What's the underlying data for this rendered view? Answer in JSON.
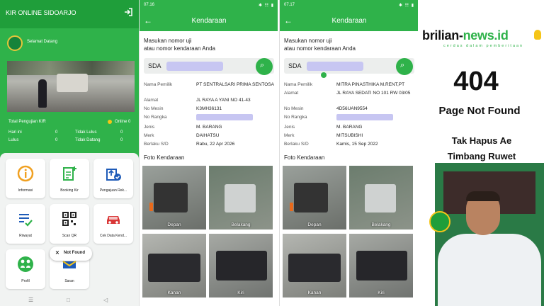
{
  "app": {
    "title": "KIR ONLINE SIDOARJO",
    "welcome": "Selamat Datang",
    "stats_title": "Total Pengujian KIR",
    "online_label": "Online 0",
    "stats": [
      {
        "label": "Hari ini",
        "value": "0"
      },
      {
        "label": "Lulus",
        "value": "0"
      },
      {
        "label": "Tidak Lulus",
        "value": "0"
      },
      {
        "label": "Tidak Datang",
        "value": "0"
      }
    ],
    "menu": [
      {
        "label": "Informasi",
        "icon": "info-icon"
      },
      {
        "label": "Booking Kir",
        "icon": "document-add-icon"
      },
      {
        "label": "Pengajuan Rek...",
        "icon": "upload-check-icon"
      },
      {
        "label": "Riwayat",
        "icon": "history-list-icon"
      },
      {
        "label": "Scan QR",
        "icon": "qr-code-icon"
      },
      {
        "label": "Cek Data Kend...",
        "icon": "car-icon"
      },
      {
        "label": "Profil",
        "icon": "profile-icon"
      },
      {
        "label": "Saran",
        "icon": "feedback-icon"
      }
    ],
    "toast": "Not Found"
  },
  "screen2": {
    "time": "07.16",
    "status_icons": "✱ ☷ ▮",
    "header": "Kendaraan",
    "prompt_line1": "Masukan nomor uji",
    "prompt_line2": "atau nomor kendaraan Anda",
    "search_prefix": "SDA",
    "fields": [
      {
        "label": "Nama Pemilik",
        "value": "PT SENTRALSARI PRIMA SENTOSA"
      },
      {
        "label": "Alamat",
        "value": "JL RAYA A YANI NO 41-43"
      },
      {
        "label": "No Mesin",
        "value": "K3MH36131"
      },
      {
        "label": "No Rangka",
        "value": ""
      },
      {
        "label": "Jenis",
        "value": "M. BARANG"
      },
      {
        "label": "Merk",
        "value": "DAIHATSU"
      },
      {
        "label": "Berlaku S/D",
        "value": "Rabu, 22 Apr 2026"
      }
    ],
    "photo_title": "Foto Kendaraan",
    "photos": [
      "Depan",
      "Belakang",
      "Kanan",
      "Kiri"
    ]
  },
  "screen3": {
    "time": "07.17",
    "status_icons": "✱ ☷ ▮",
    "header": "Kendaraan",
    "prompt_line1": "Masukan nomor uji",
    "prompt_line2": "atau nomor kendaraan Anda",
    "search_prefix": "SDA",
    "fields": [
      {
        "label": "Nama Pemilik",
        "value": "MITRA PINASTHIKA M.RENT,PT"
      },
      {
        "label": "Alamat",
        "value": "JL RAYA SEDATI NO 101 RW 03/05"
      },
      {
        "label": "No Mesin",
        "value": "4D56UAN9554"
      },
      {
        "label": "No Rangka",
        "value": ""
      },
      {
        "label": "Jenis",
        "value": "M. BARANG"
      },
      {
        "label": "Merk",
        "value": "MITSUBISHI"
      },
      {
        "label": "Berlaku S/D",
        "value": "Kamis, 15 Sep 2022"
      }
    ],
    "photo_title": "Foto Kendaraan",
    "photos": [
      "Depan",
      "Belakang",
      "Kanan",
      "Kiri"
    ]
  },
  "article": {
    "brand_main": "brilian-",
    "brand_accent": "news.id",
    "tagline": "cerdas dalam pemberitaan",
    "code": "404",
    "message": "Page Not Found",
    "slogan_line1": "Tak Hapus Ae",
    "slogan_line2": "Timbang Ruwet"
  },
  "colors": {
    "primary_green": "#2fb24a",
    "dark_green": "#1f9e3a",
    "redaction": "#c7c6f2"
  }
}
